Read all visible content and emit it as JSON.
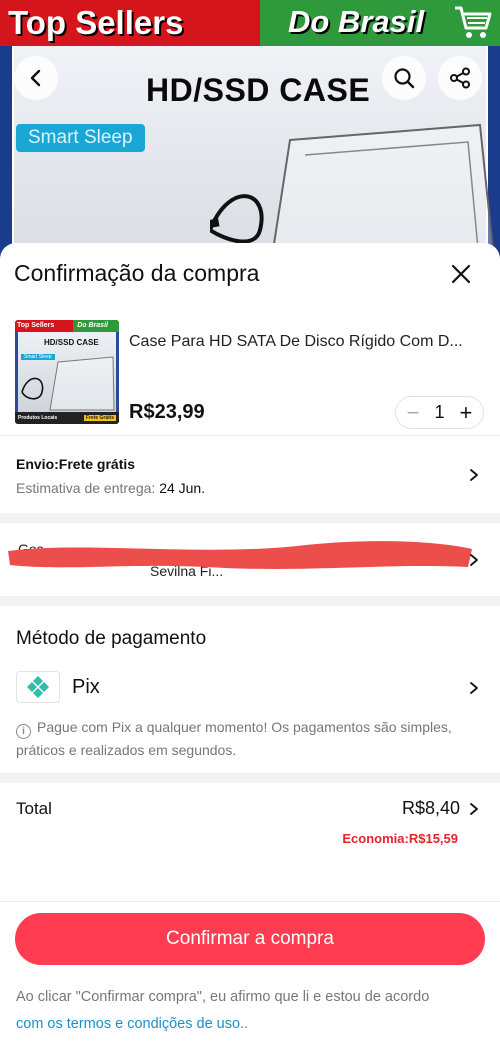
{
  "banner": {
    "brand_left": "Top Sellers",
    "brand_right": "Do Brasil",
    "product_headline": "HD/SSD CASE",
    "feature_tag": "Smart Sleep",
    "buttons": {
      "back": "chevron-left-icon",
      "search": "search-icon",
      "share": "share-icon"
    }
  },
  "sheet": {
    "title": "Confirmação da compra",
    "close_icon": "close-icon"
  },
  "product": {
    "thumbnail": {
      "brand_left": "Top Sellers",
      "brand_right": "Do Brasil",
      "headline": "HD/SSD CASE",
      "tag": "Smart Sleep",
      "footer_left": "Produtos Locais",
      "footer_right": "Frete Grátis"
    },
    "name": "Case Para HD SATA De Disco Rígido Com D...",
    "price": "R$23,99",
    "quantity": "1",
    "minus": "−",
    "plus": "+"
  },
  "shipping": {
    "label": "Envio:Frete grátis",
    "estimate_label": "Estimativa de entrega:",
    "estimate_date": "24 Jun."
  },
  "address": {
    "line1": "Gos...",
    "line2": "Sevilna Fi..."
  },
  "payment": {
    "title": "Método de pagamento",
    "method": "Pix",
    "note": "Pague com Pix a qualquer momento! Os pagamentos são simples, práticos e realizados em segundos."
  },
  "total": {
    "label": "Total",
    "value": "R$8,40",
    "saving": "Economia:R$15,59"
  },
  "confirm": {
    "label": "Confirmar a compra"
  },
  "legal": {
    "text": "Ao clicar \"Confirmar compra\", eu afirmo que li e estou de acordo ",
    "link": "com os termos e condições de uso",
    "suffix": ".."
  },
  "colors": {
    "accent": "#ff3c52",
    "saving": "#e0262d",
    "link": "#1e8fc8",
    "pix": "#32bcad"
  }
}
